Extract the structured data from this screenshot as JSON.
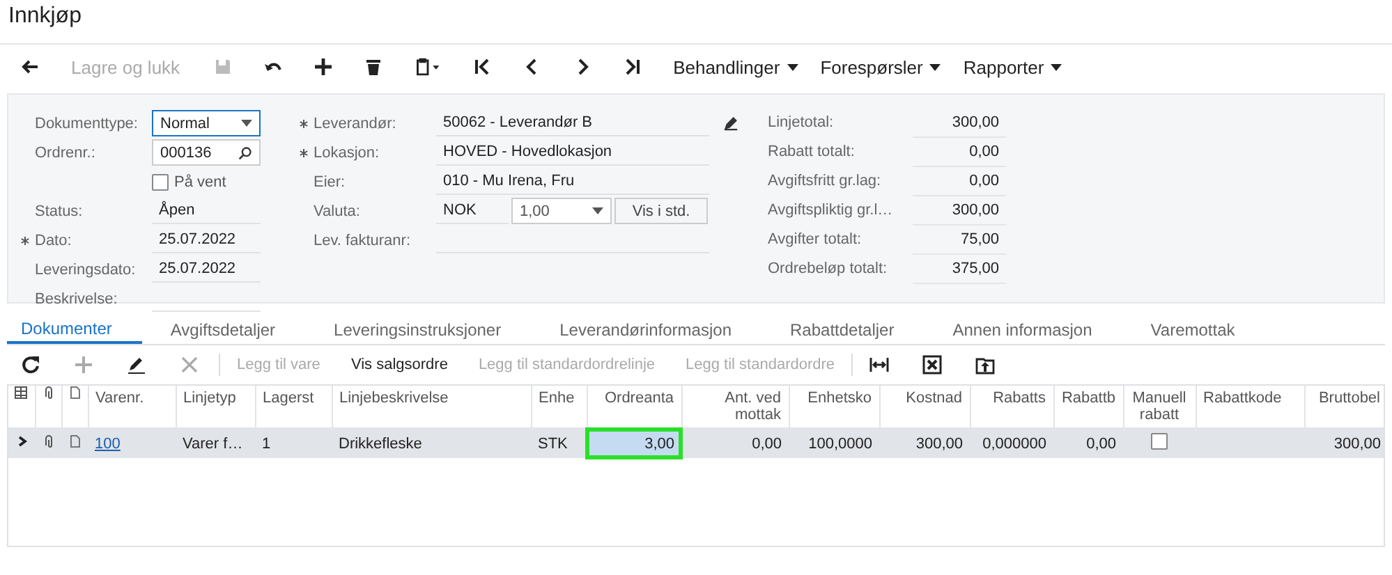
{
  "window": {
    "title": "Innkjøp"
  },
  "toolbar": {
    "save_close": {
      "label": "Lagre og lukk",
      "disabled": true
    },
    "menus": [
      {
        "label": "Behandlinger"
      },
      {
        "label": "Forespørsler"
      },
      {
        "label": "Rapporter"
      }
    ]
  },
  "form": {
    "left": [
      {
        "label": "Dokumenttype:",
        "required": false,
        "kind": "select",
        "value": "Normal",
        "focused": true
      },
      {
        "label": "Ordrenr.:",
        "required": false,
        "kind": "search",
        "value": "000136",
        "focused": false
      },
      {
        "label": "På vent",
        "kind": "checkbox",
        "checked": false
      },
      {
        "label": "Status:",
        "required": false,
        "kind": "text",
        "value": "Åpen"
      },
      {
        "label": "Dato:",
        "required": true,
        "kind": "text",
        "value": "25.07.2022"
      },
      {
        "label": "Leveringsdato:",
        "required": false,
        "kind": "text",
        "value": "25.07.2022"
      },
      {
        "label": "Beskrivelse:",
        "required": false,
        "kind": "text"
      }
    ],
    "middle": [
      {
        "label": "Leverandør:",
        "required": true,
        "kind": "text",
        "value": "50062 - Leverandør B"
      },
      {
        "label": "Lokasjon:",
        "required": true,
        "kind": "text",
        "value": "HOVED - Hovedlokasjon"
      },
      {
        "label": "Eier:",
        "required": false,
        "kind": "text",
        "value": "010 - Mu Irena, Fru"
      },
      {
        "label": "Valuta:",
        "required": false,
        "kind": "currency",
        "value": "NOK",
        "rate": "1,00",
        "button": "Vis i std."
      },
      {
        "label": "Lev. fakturanr:",
        "required": false,
        "kind": "text"
      }
    ],
    "totals": [
      {
        "label": "Linjetotal:",
        "value": "300,00"
      },
      {
        "label": "Rabatt totalt:",
        "value": "0,00"
      },
      {
        "label": "Avgiftsfritt gr.lag:",
        "value": "0,00"
      },
      {
        "label": "Avgiftspliktig gr.l…",
        "value": "300,00"
      },
      {
        "label": "Avgifter totalt:",
        "value": "75,00"
      },
      {
        "label": "Ordrebeløp totalt:",
        "value": "375,00"
      }
    ]
  },
  "tabs": [
    {
      "label": "Dokumenter",
      "selected": true
    },
    {
      "label": "Avgiftsdetaljer",
      "selected": false
    },
    {
      "label": "Leveringsinstruksjoner",
      "selected": false
    },
    {
      "label": "Leverandørinformasjon",
      "selected": false
    },
    {
      "label": "Rabattdetaljer",
      "selected": false
    },
    {
      "label": "Annen informasjon",
      "selected": false
    },
    {
      "label": "Varemottak",
      "selected": false
    }
  ],
  "grid_toolbar": {
    "add_disabled": true,
    "delete_disabled": true,
    "buttons": [
      {
        "label": "Legg til vare",
        "disabled": true
      },
      {
        "label": "Vis salgsordre",
        "disabled": false
      },
      {
        "label": "Legg til standardordrelinje",
        "disabled": true
      },
      {
        "label": "Legg til standardordre",
        "disabled": true
      }
    ]
  },
  "table": {
    "columns": [
      {
        "label": "Varenr."
      },
      {
        "label": "Linjetyp"
      },
      {
        "label": "Lagerst"
      },
      {
        "label": "Linjebeskrivelse"
      },
      {
        "label": "Enhe"
      },
      {
        "label": "Ordreanta"
      },
      {
        "label": "Ant. ved mottak"
      },
      {
        "label": "Enhetsko"
      },
      {
        "label": "Kostnad"
      },
      {
        "label": "Rabatts"
      },
      {
        "label": "Rabattb"
      },
      {
        "label": "Manuell rabatt"
      },
      {
        "label": "Rabattkode"
      },
      {
        "label": "Bruttobel"
      }
    ],
    "rows": [
      {
        "selected": true,
        "cells": [
          {
            "kind": "link",
            "text": "100",
            "highlighted": false
          },
          {
            "kind": "text",
            "text": "Varer f…",
            "highlighted": false
          },
          {
            "kind": "text",
            "text": "1",
            "highlighted": false
          },
          {
            "kind": "text",
            "text": "Drikkefleske",
            "highlighted": false
          },
          {
            "kind": "text",
            "text": "STK",
            "highlighted": false
          },
          {
            "kind": "text",
            "text": "3,00",
            "highlighted": true
          },
          {
            "kind": "text",
            "text": "0,00",
            "highlighted": false
          },
          {
            "kind": "text",
            "text": "100,0000",
            "highlighted": false
          },
          {
            "kind": "text",
            "text": "300,00",
            "highlighted": false
          },
          {
            "kind": "text",
            "text": "0,000000",
            "highlighted": false
          },
          {
            "kind": "text",
            "text": "0,00",
            "highlighted": false
          },
          {
            "kind": "checkbox",
            "checked": false,
            "highlighted": false
          },
          {
            "kind": "empty",
            "highlighted": false
          },
          {
            "kind": "text",
            "text": "300,00",
            "highlighted": false
          }
        ]
      }
    ]
  }
}
